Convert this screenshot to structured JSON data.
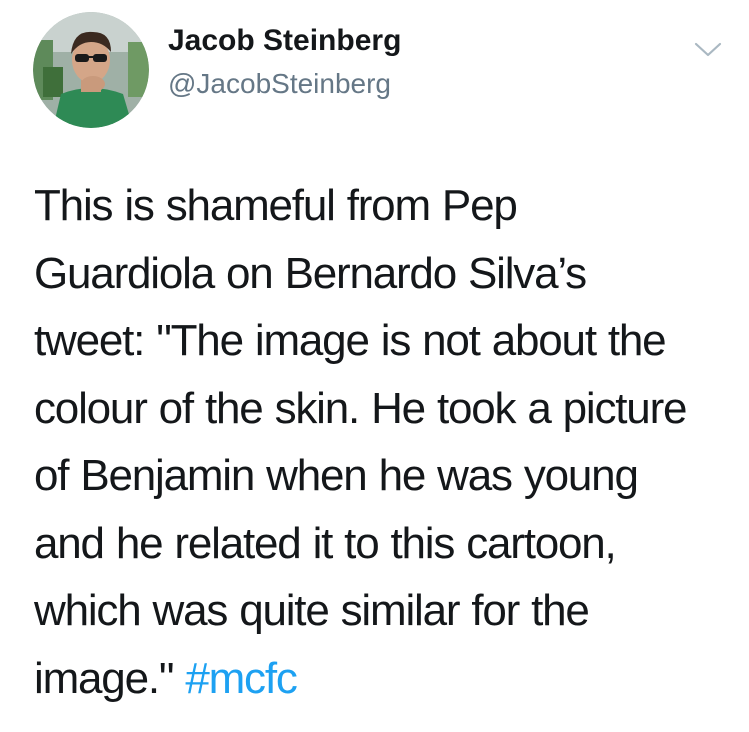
{
  "author": {
    "display_name": "Jacob Steinberg",
    "handle": "@JacobSteinberg",
    "avatar_icon": "profile-photo"
  },
  "menu": {
    "icon": "chevron-down-icon"
  },
  "tweet": {
    "lines": [
      "This is shameful from Pep",
      "Guardiola on Bernardo Silva’s",
      "tweet: \"The image is not about the",
      "colour of the skin. He took a picture",
      "of Benjamin when he was young",
      "and he related it to this cartoon,",
      "which was quite similar for the"
    ],
    "last_line_text": "image.\" ",
    "hashtag": "#mcfc"
  },
  "colors": {
    "text": "#14171a",
    "secondary": "#657786",
    "link": "#1da1f2"
  }
}
